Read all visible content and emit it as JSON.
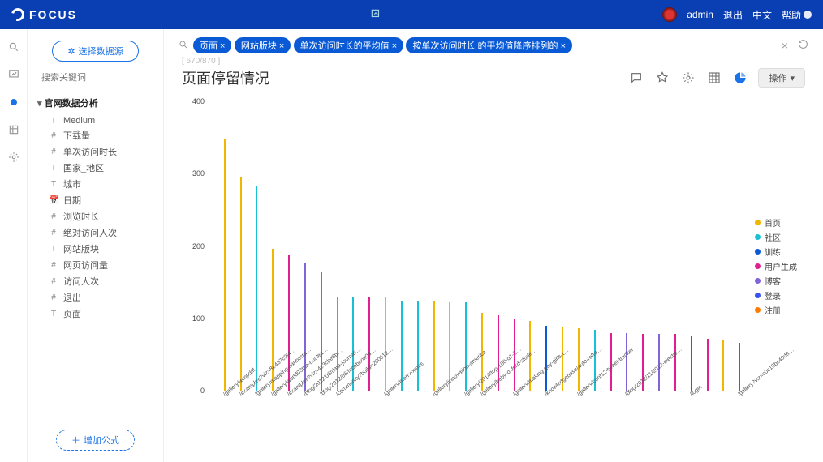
{
  "app": {
    "brand": "FOCUS"
  },
  "topbar": {
    "user": "admin",
    "logout": "退出",
    "lang": "中文",
    "help": "帮助"
  },
  "sidebar": {
    "select_source": "选择数据源",
    "search_placeholder": "搜索关键词",
    "root": "官网数据分析",
    "fields": [
      {
        "ico": "T",
        "label": "Medium"
      },
      {
        "ico": "#",
        "label": "下载量"
      },
      {
        "ico": "#",
        "label": "单次访问时长"
      },
      {
        "ico": "T",
        "label": "国家_地区"
      },
      {
        "ico": "T",
        "label": "城市"
      },
      {
        "ico": "📅",
        "label": "日期"
      },
      {
        "ico": "#",
        "label": "浏览时长"
      },
      {
        "ico": "#",
        "label": "绝对访问人次"
      },
      {
        "ico": "T",
        "label": "网站版块"
      },
      {
        "ico": "#",
        "label": "网页访问量"
      },
      {
        "ico": "#",
        "label": "访问人次"
      },
      {
        "ico": "#",
        "label": "退出"
      },
      {
        "ico": "T",
        "label": "页面"
      }
    ],
    "add_formula": "增加公式"
  },
  "query": {
    "pills": [
      "页面 ×",
      "网站版块 ×",
      "单次访问时长的平均值 ×",
      "按单次访问时长 的平均值降序排列的 ×"
    ],
    "crumb": "[ 670/870 ]"
  },
  "page": {
    "title": "页面停留情况",
    "operate": "操作"
  },
  "legend": [
    {
      "name": "首页",
      "color": "#f2b600"
    },
    {
      "name": "社区",
      "color": "#18c0d6"
    },
    {
      "name": "训练",
      "color": "#0a5ad6"
    },
    {
      "name": "用户生成",
      "color": "#e11f8f"
    },
    {
      "name": "博客",
      "color": "#8364d8"
    },
    {
      "name": "登录",
      "color": "#3753f2"
    },
    {
      "name": "注册",
      "color": "#ff7a00"
    }
  ],
  "chart_data": {
    "type": "bar",
    "ylabel": "",
    "ylim": [
      0,
      400
    ],
    "yticks": [
      0,
      100,
      200,
      300,
      400
    ],
    "series_colors": {
      "首页": "#f2b600",
      "社区": "#18c0d6",
      "训练": "#0a5ad6",
      "用户生成": "#e11f8f",
      "博客": "#8364d8",
      "登录": "#3753f2",
      "注册": "#ff7a00"
    },
    "points": [
      {
        "x": "/gallery/tempdiff",
        "v": 348,
        "c": "首页"
      },
      {
        "x": "/examples?viz=8e437c9f4278d0...",
        "v": 296,
        "c": "首页"
      },
      {
        "x": "/gallery/mapping-canberra-aus...",
        "v": 282,
        "c": "社区"
      },
      {
        "x": "/gallery/world03the-nuclear-a...",
        "v": 196,
        "c": "首页"
      },
      {
        "x": "/examples?viz=4e3cbe8b8ba42c...",
        "v": 188,
        "c": "用户生成"
      },
      {
        "x": "/blog/2012/06/data-journalism...",
        "v": 176,
        "c": "博客"
      },
      {
        "x": "/blog/2012/06/facebook039s-d...",
        "v": 164,
        "c": "博客"
      },
      {
        "x": "/community?build=200612.1018...",
        "v": 130,
        "c": "社区"
      },
      {
        "x": "",
        "v": 130,
        "c": "社区"
      },
      {
        "x": "",
        "v": 130,
        "c": "用户生成"
      },
      {
        "x": "/gallery/merry-xmas",
        "v": 130,
        "c": "首页"
      },
      {
        "x": "",
        "v": 124,
        "c": "社区"
      },
      {
        "x": "",
        "v": 124,
        "c": "社区"
      },
      {
        "x": "/gallery/innovation-america",
        "v": 124,
        "c": "首页"
      },
      {
        "x": "",
        "v": 122,
        "c": "首页"
      },
      {
        "x": "/gallery/2014/top-100-q1-2012...",
        "v": 122,
        "c": "社区"
      },
      {
        "x": "/gallery/baby-oxford-students",
        "v": 108,
        "c": "首页"
      },
      {
        "x": "",
        "v": 104,
        "c": "用户生成"
      },
      {
        "x": "/gallery/making-gay-girls-too...",
        "v": 100,
        "c": "用户生成"
      },
      {
        "x": "",
        "v": 96,
        "c": "首页"
      },
      {
        "x": "/knowledgebase/auto-refreshin...",
        "v": 90,
        "c": "训练"
      },
      {
        "x": "",
        "v": 88,
        "c": "首页"
      },
      {
        "x": "/gallery/conf12-tweet-tracker",
        "v": 86,
        "c": "首页"
      },
      {
        "x": "",
        "v": 84,
        "c": "社区"
      },
      {
        "x": "",
        "v": 80,
        "c": "用户生成"
      },
      {
        "x": "/blog/2012/11/2012-election-g...",
        "v": 80,
        "c": "博客"
      },
      {
        "x": "",
        "v": 78,
        "c": "用户生成"
      },
      {
        "x": "",
        "v": 78,
        "c": "博客"
      },
      {
        "x": "",
        "v": 78,
        "c": "用户生成"
      },
      {
        "x": "/login",
        "v": 76,
        "c": "登录"
      },
      {
        "x": "",
        "v": 72,
        "c": "用户生成"
      },
      {
        "x": "",
        "v": 70,
        "c": "首页"
      },
      {
        "x": "/gallery?viz=c0c18bc40d84a0...",
        "v": 66,
        "c": "用户生成"
      }
    ]
  }
}
